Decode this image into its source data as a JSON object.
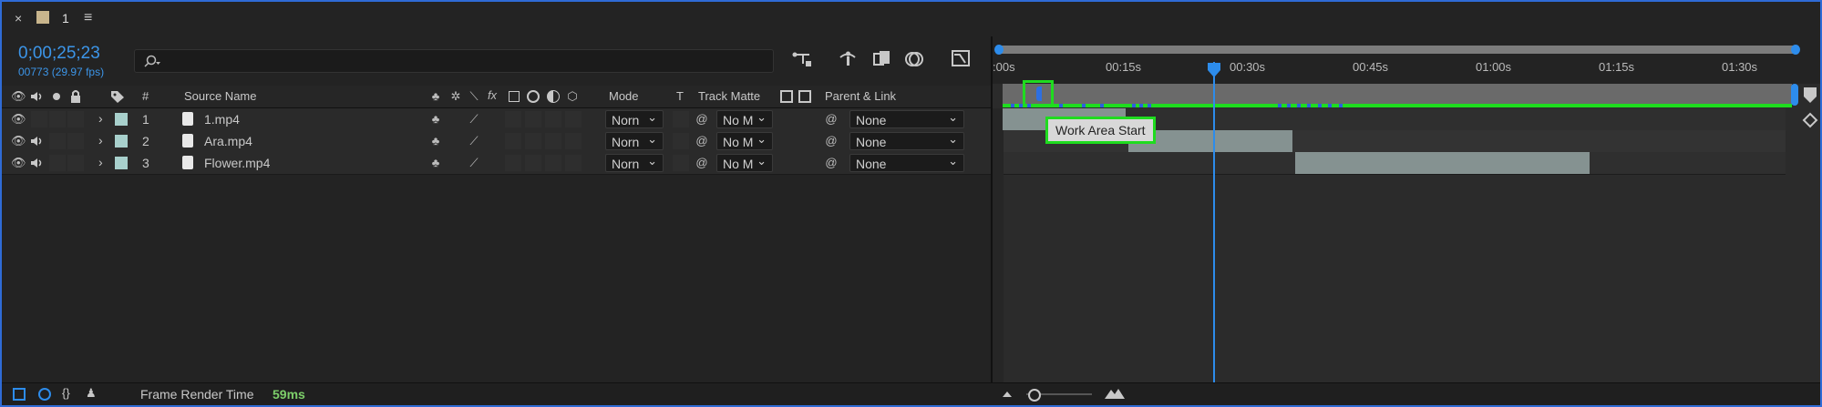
{
  "panel": {
    "close_glyph": "×",
    "tab_name": "1",
    "menu_glyph": "≡"
  },
  "timecode": {
    "value": "0;00;25;23",
    "frames": "00773 (29.97 fps)"
  },
  "search": {
    "placeholder": ""
  },
  "columns": {
    "number": "#",
    "source_name": "Source Name",
    "mode": "Mode",
    "t": "T",
    "track_matte": "Track Matte",
    "parent_link": "Parent & Link"
  },
  "layers": [
    {
      "num": "1",
      "name": "1.mp4",
      "mode": "Norn",
      "matte": "No M",
      "parent": "None"
    },
    {
      "num": "2",
      "name": "Ara.mp4",
      "mode": "Norn",
      "matte": "No M",
      "parent": "None"
    },
    {
      "num": "3",
      "name": "Flower.mp4",
      "mode": "Norn",
      "matte": "No M",
      "parent": "None"
    }
  ],
  "ruler": {
    "ticks": [
      ":00s",
      "00:15s",
      "00:30s",
      "00:45s",
      "01:00s",
      "01:15s",
      "01:30s"
    ]
  },
  "tooltip": {
    "text": "Work Area Start"
  },
  "status": {
    "label": "Frame Render Time",
    "value": "59ms"
  },
  "colors": {
    "accent_blue": "#2d8ceb",
    "highlight_green": "#1fdc1f",
    "label_teal": "#a8d0cc",
    "render_green": "#7dcf6a"
  }
}
